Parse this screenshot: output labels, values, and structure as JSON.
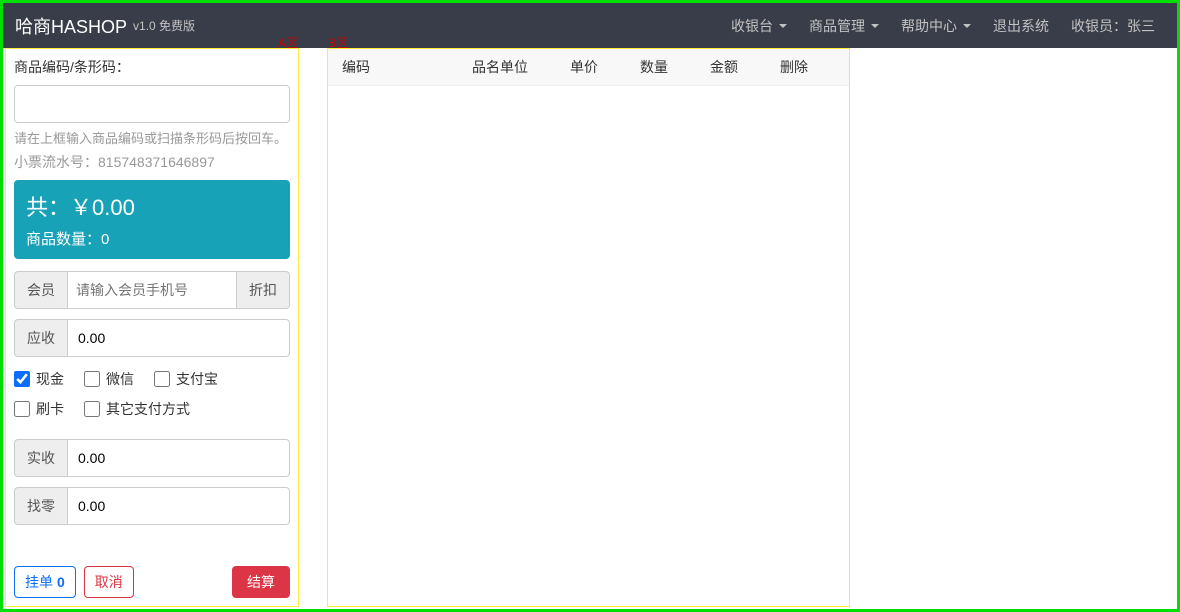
{
  "header": {
    "brand": "哈商HASHOP",
    "version": "v1.0 免费版",
    "nav": {
      "cashier": "收银台",
      "product": "商品管理",
      "help": "帮助中心",
      "logout": "退出系统",
      "cashier_label": "收银员：张三"
    }
  },
  "zones": {
    "a_label": "A区",
    "b_label": "B区"
  },
  "panel_a": {
    "barcode_label": "商品编码/条形码：",
    "barcode_value": "",
    "help_text": "请在上框输入商品编码或扫描条形码后按回车。",
    "serial_prefix": "小票流水号：",
    "serial_number": "815748371646897",
    "total_prefix": "共：￥",
    "total_value": "0.00",
    "count_prefix": "商品数量：",
    "count_value": "0",
    "member_label": "会员",
    "member_placeholder": "请输入会员手机号",
    "discount_label": "折扣",
    "receivable_label": "应收",
    "receivable_value": "0.00",
    "pay_cash": "现金",
    "pay_wechat": "微信",
    "pay_alipay": "支付宝",
    "pay_card": "刷卡",
    "pay_other": "其它支付方式",
    "actual_label": "实收",
    "actual_value": "0.00",
    "change_label": "找零",
    "change_value": "0.00",
    "btn_hold": "挂单",
    "hold_count": "0",
    "btn_cancel": "取消",
    "btn_settle": "结算"
  },
  "panel_b": {
    "cols": {
      "code": "编码",
      "name": "品名",
      "unit": "单位",
      "price": "单价",
      "qty": "数量",
      "amount": "金额",
      "delete": "删除"
    }
  }
}
